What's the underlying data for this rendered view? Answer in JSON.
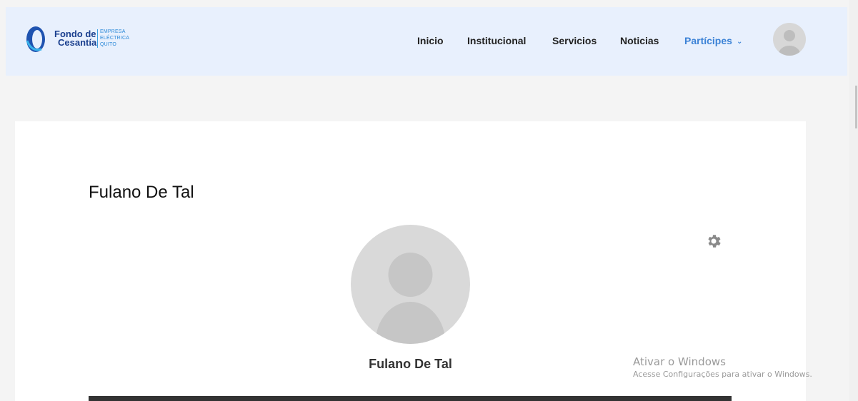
{
  "header": {
    "logo": {
      "line1": "Fondo de",
      "line2": "Cesantía",
      "sub1": "EMPRESA",
      "sub2": "ELÉCTRICA",
      "sub3": "QUITO"
    },
    "nav": [
      {
        "label": "Inicio"
      },
      {
        "label": "Institucional"
      },
      {
        "label": "Servicios"
      },
      {
        "label": "Noticias"
      },
      {
        "label": "Partícipes"
      }
    ],
    "nav_active_color": "#3b82d6"
  },
  "profile": {
    "title": "Fulano De Tal",
    "name": "Fulano De Tal"
  },
  "watermark": {
    "line1": "Ativar o Windows",
    "line2": "Acesse Configurações para ativar o Windows."
  },
  "icons": {
    "settings": "gear-icon",
    "avatar": "user-avatar-icon",
    "dropdown": "chevron-down-icon"
  }
}
